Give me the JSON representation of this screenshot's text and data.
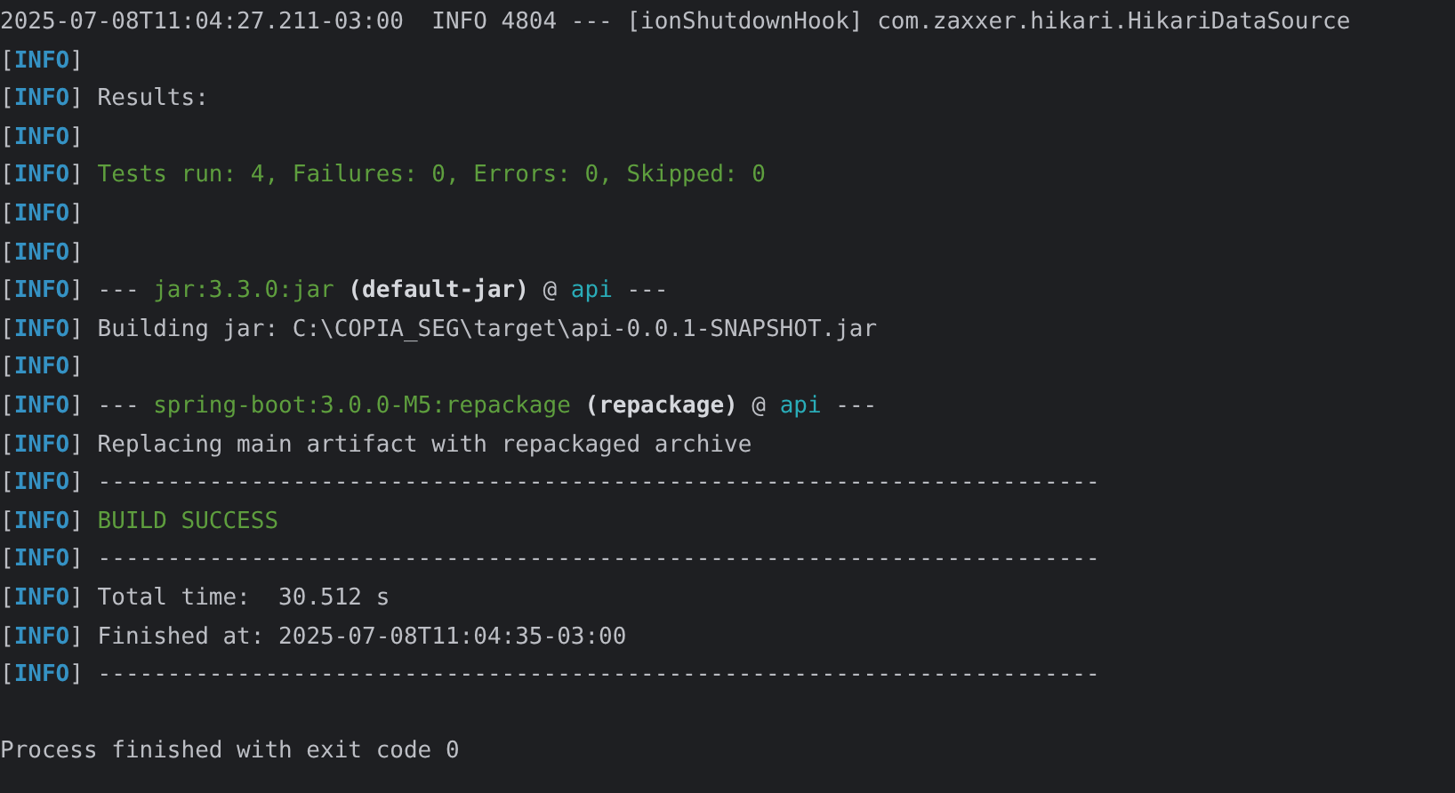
{
  "console": {
    "lines": [
      {
        "segments": [
          {
            "kind": "text",
            "text": "2025-07-08T11:04:27.211-03:00  INFO 4804 --- [ionShutdownHook] com.zaxxer.hikari.HikariDataSource"
          }
        ]
      },
      {
        "segments": [
          {
            "kind": "bracket",
            "text": "["
          },
          {
            "kind": "level",
            "text": "INFO"
          },
          {
            "kind": "bracket",
            "text": "]"
          }
        ]
      },
      {
        "segments": [
          {
            "kind": "bracket",
            "text": "["
          },
          {
            "kind": "level",
            "text": "INFO"
          },
          {
            "kind": "bracket",
            "text": "]"
          },
          {
            "kind": "text",
            "text": " Results:"
          }
        ]
      },
      {
        "segments": [
          {
            "kind": "bracket",
            "text": "["
          },
          {
            "kind": "level",
            "text": "INFO"
          },
          {
            "kind": "bracket",
            "text": "]"
          }
        ]
      },
      {
        "segments": [
          {
            "kind": "bracket",
            "text": "["
          },
          {
            "kind": "level",
            "text": "INFO"
          },
          {
            "kind": "bracket",
            "text": "]"
          },
          {
            "kind": "success",
            "text": " Tests run: 4, Failures: 0, Errors: 0, Skipped: 0"
          }
        ]
      },
      {
        "segments": [
          {
            "kind": "bracket",
            "text": "["
          },
          {
            "kind": "level",
            "text": "INFO"
          },
          {
            "kind": "bracket",
            "text": "]"
          }
        ]
      },
      {
        "segments": [
          {
            "kind": "bracket",
            "text": "["
          },
          {
            "kind": "level",
            "text": "INFO"
          },
          {
            "kind": "bracket",
            "text": "]"
          }
        ]
      },
      {
        "segments": [
          {
            "kind": "bracket",
            "text": "["
          },
          {
            "kind": "level",
            "text": "INFO"
          },
          {
            "kind": "bracket",
            "text": "]"
          },
          {
            "kind": "text",
            "text": " --- "
          },
          {
            "kind": "plugin",
            "text": "jar:3.3.0:jar"
          },
          {
            "kind": "execution",
            "text": " (default-jar)"
          },
          {
            "kind": "text",
            "text": " @ "
          },
          {
            "kind": "project",
            "text": "api"
          },
          {
            "kind": "text",
            "text": " ---"
          }
        ]
      },
      {
        "segments": [
          {
            "kind": "bracket",
            "text": "["
          },
          {
            "kind": "level",
            "text": "INFO"
          },
          {
            "kind": "bracket",
            "text": "]"
          },
          {
            "kind": "text",
            "text": " Building jar: C:\\COPIA_SEG\\target\\api-0.0.1-SNAPSHOT.jar"
          }
        ]
      },
      {
        "segments": [
          {
            "kind": "bracket",
            "text": "["
          },
          {
            "kind": "level",
            "text": "INFO"
          },
          {
            "kind": "bracket",
            "text": "]"
          }
        ]
      },
      {
        "segments": [
          {
            "kind": "bracket",
            "text": "["
          },
          {
            "kind": "level",
            "text": "INFO"
          },
          {
            "kind": "bracket",
            "text": "]"
          },
          {
            "kind": "text",
            "text": " --- "
          },
          {
            "kind": "plugin",
            "text": "spring-boot:3.0.0-M5:repackage"
          },
          {
            "kind": "execution",
            "text": " (repackage)"
          },
          {
            "kind": "text",
            "text": " @ "
          },
          {
            "kind": "project",
            "text": "api"
          },
          {
            "kind": "text",
            "text": " ---"
          }
        ]
      },
      {
        "segments": [
          {
            "kind": "bracket",
            "text": "["
          },
          {
            "kind": "level",
            "text": "INFO"
          },
          {
            "kind": "bracket",
            "text": "]"
          },
          {
            "kind": "text",
            "text": " Replacing main artifact with repackaged archive"
          }
        ]
      },
      {
        "segments": [
          {
            "kind": "bracket",
            "text": "["
          },
          {
            "kind": "level",
            "text": "INFO"
          },
          {
            "kind": "bracket",
            "text": "]"
          },
          {
            "kind": "text",
            "text": " ------------------------------------------------------------------------"
          }
        ]
      },
      {
        "segments": [
          {
            "kind": "bracket",
            "text": "["
          },
          {
            "kind": "level",
            "text": "INFO"
          },
          {
            "kind": "bracket",
            "text": "]"
          },
          {
            "kind": "success",
            "text": " BUILD SUCCESS"
          }
        ]
      },
      {
        "segments": [
          {
            "kind": "bracket",
            "text": "["
          },
          {
            "kind": "level",
            "text": "INFO"
          },
          {
            "kind": "bracket",
            "text": "]"
          },
          {
            "kind": "text",
            "text": " ------------------------------------------------------------------------"
          }
        ]
      },
      {
        "segments": [
          {
            "kind": "bracket",
            "text": "["
          },
          {
            "kind": "level",
            "text": "INFO"
          },
          {
            "kind": "bracket",
            "text": "]"
          },
          {
            "kind": "text",
            "text": " Total time:  30.512 s"
          }
        ]
      },
      {
        "segments": [
          {
            "kind": "bracket",
            "text": "["
          },
          {
            "kind": "level",
            "text": "INFO"
          },
          {
            "kind": "bracket",
            "text": "]"
          },
          {
            "kind": "text",
            "text": " Finished at: 2025-07-08T11:04:35-03:00"
          }
        ]
      },
      {
        "segments": [
          {
            "kind": "bracket",
            "text": "["
          },
          {
            "kind": "level",
            "text": "INFO"
          },
          {
            "kind": "bracket",
            "text": "]"
          },
          {
            "kind": "text",
            "text": " ------------------------------------------------------------------------"
          }
        ]
      },
      {
        "kind": "blank"
      },
      {
        "segments": [
          {
            "kind": "process",
            "text": "Process finished with exit code 0"
          }
        ]
      }
    ]
  }
}
